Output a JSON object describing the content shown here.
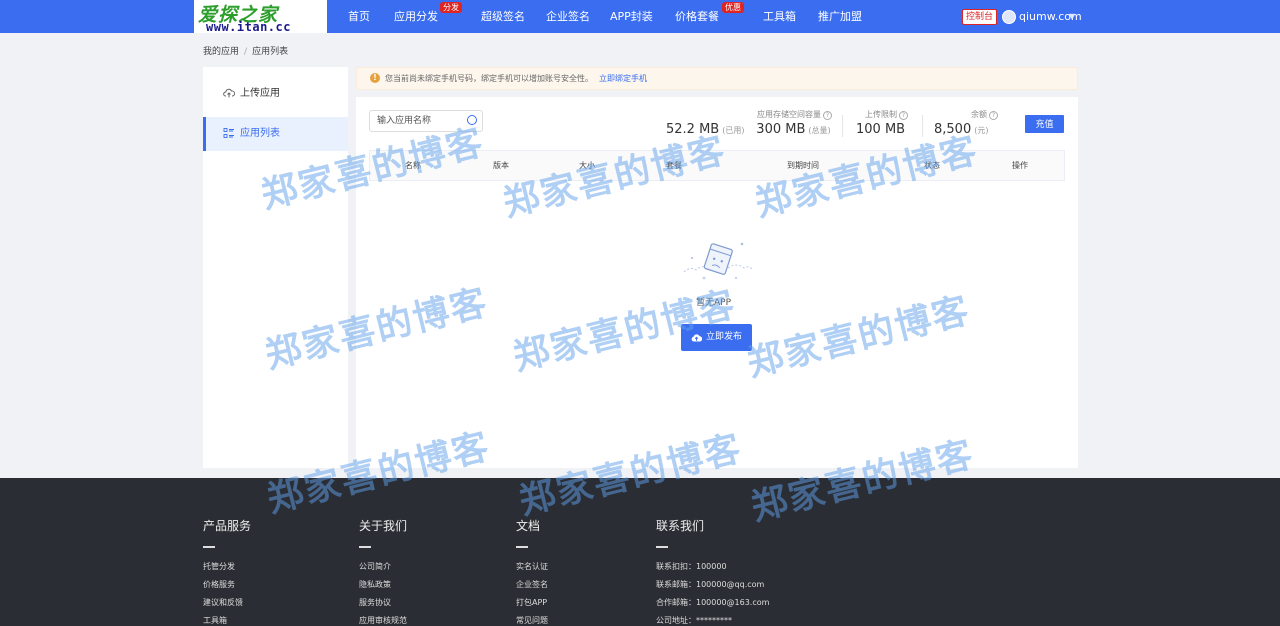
{
  "brand": {
    "logo_cn": "爱探之家",
    "logo_en": "www.itan.cc"
  },
  "nav": {
    "items": [
      {
        "label": "首页"
      },
      {
        "label": "应用分发",
        "badge": "分发"
      },
      {
        "label": "超级签名"
      },
      {
        "label": "企业签名"
      },
      {
        "label": "APP封装"
      },
      {
        "label": "价格套餐",
        "badge": "优惠"
      },
      {
        "label": "工具箱"
      },
      {
        "label": "推广加盟"
      }
    ],
    "console_label": "控制台",
    "username": "qiumw.com"
  },
  "breadcrumb": {
    "items": [
      "我的应用",
      "应用列表"
    ],
    "separator": "/"
  },
  "sidebar": {
    "items": [
      {
        "label": "上传应用",
        "icon": "cloud-upload-icon",
        "active": false
      },
      {
        "label": "应用列表",
        "icon": "list-icon",
        "active": true
      }
    ]
  },
  "notice": {
    "text": "您当前尚未绑定手机号码，绑定手机可以增加账号安全性。",
    "link": "立即绑定手机",
    "color": "#e6a23c"
  },
  "search": {
    "placeholder": "输入应用名称",
    "value": ""
  },
  "stats": {
    "storage": {
      "label": "应用存储空间容量",
      "used": "52.2 MB",
      "used_unit": "(已用)",
      "total": "300 MB",
      "total_unit": "(总量)"
    },
    "upload_limit": {
      "label": "上传限制",
      "value": "100 MB"
    },
    "balance": {
      "label": "余额",
      "value": "8,500",
      "unit": "(元)"
    },
    "recharge_label": "充值"
  },
  "table": {
    "columns": [
      "名称",
      "版本",
      "大小",
      "套餐",
      "到期时间",
      "状态",
      "操作"
    ],
    "rows": []
  },
  "empty": {
    "text": "暂无APP",
    "button_label": "立即发布"
  },
  "footer": {
    "columns": [
      {
        "title": "产品服务",
        "links": [
          "托管分发",
          "价格服务",
          "建议和反馈",
          "工具箱"
        ]
      },
      {
        "title": "关于我们",
        "links": [
          "公司简介",
          "隐私政策",
          "服务协议",
          "应用审核规范"
        ]
      },
      {
        "title": "文档",
        "links": [
          "实名认证",
          "企业签名",
          "打包APP",
          "常见问题"
        ]
      },
      {
        "title": "联系我们",
        "links": [
          "联系扣扣：100000",
          "联系邮箱：100000@qq.com",
          "合作邮箱：100000@163.com",
          "公司地址：*********"
        ]
      }
    ]
  },
  "watermark": {
    "text": "郑家喜的博客"
  },
  "colors": {
    "primary": "#3a6df0",
    "nav_bg": "#3a6df0",
    "footer_bg": "#2a2d33",
    "badge": "#e02424"
  }
}
